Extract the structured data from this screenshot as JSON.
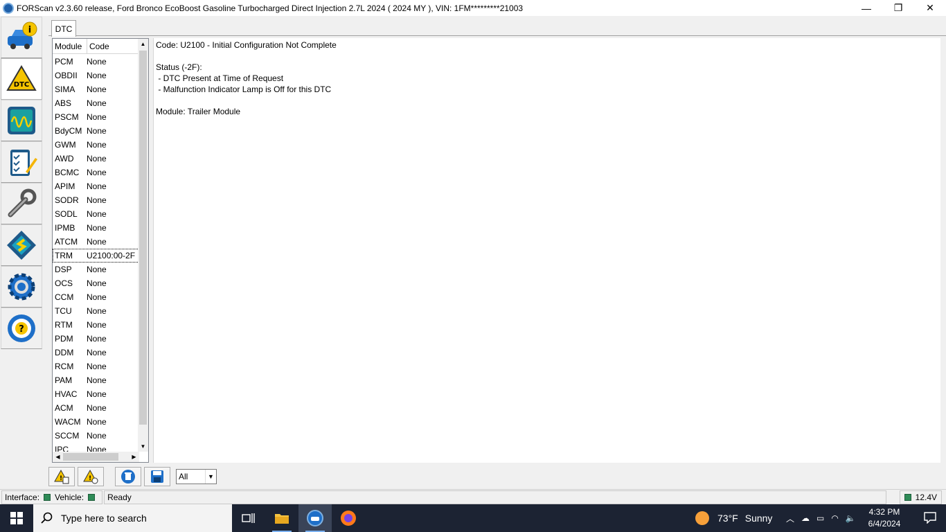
{
  "window": {
    "title": "FORScan v2.3.60 release, Ford Bronco EcoBoost Gasoline Turbocharged Direct Injection 2.7L 2024 ( 2024 MY ), VIN: 1FM*********21003",
    "minimize_glyph": "—",
    "restore_glyph": "❐",
    "close_glyph": "✕"
  },
  "sidebar": {
    "items": [
      {
        "icon": "vehicle-info-icon"
      },
      {
        "icon": "dtc-warning-icon",
        "label": "DTC",
        "active": true
      },
      {
        "icon": "oscilloscope-icon"
      },
      {
        "icon": "checklist-icon"
      },
      {
        "icon": "wrench-icon"
      },
      {
        "icon": "chip-icon"
      },
      {
        "icon": "settings-gear-icon"
      },
      {
        "icon": "help-steering-icon"
      }
    ]
  },
  "tabs": [
    {
      "label": "DTC"
    }
  ],
  "module_list": {
    "headers": {
      "module": "Module",
      "code": "Code"
    },
    "rows": [
      {
        "module": "PCM",
        "code": "None"
      },
      {
        "module": "OBDII",
        "code": "None"
      },
      {
        "module": "SIMA",
        "code": "None"
      },
      {
        "module": "ABS",
        "code": "None"
      },
      {
        "module": "PSCM",
        "code": "None"
      },
      {
        "module": "BdyCM",
        "code": "None"
      },
      {
        "module": "GWM",
        "code": "None"
      },
      {
        "module": "AWD",
        "code": "None"
      },
      {
        "module": "BCMC",
        "code": "None"
      },
      {
        "module": "APIM",
        "code": "None"
      },
      {
        "module": "SODR",
        "code": "None"
      },
      {
        "module": "SODL",
        "code": "None"
      },
      {
        "module": "IPMB",
        "code": "None"
      },
      {
        "module": "ATCM",
        "code": "None"
      },
      {
        "module": "TRM",
        "code": "U2100:00-2F",
        "selected": true
      },
      {
        "module": "DSP",
        "code": "None"
      },
      {
        "module": "OCS",
        "code": "None"
      },
      {
        "module": "CCM",
        "code": "None"
      },
      {
        "module": "TCU",
        "code": "None"
      },
      {
        "module": "RTM",
        "code": "None"
      },
      {
        "module": "PDM",
        "code": "None"
      },
      {
        "module": "DDM",
        "code": "None"
      },
      {
        "module": "RCM",
        "code": "None"
      },
      {
        "module": "PAM",
        "code": "None"
      },
      {
        "module": "HVAC",
        "code": "None"
      },
      {
        "module": "ACM",
        "code": "None"
      },
      {
        "module": "WACM",
        "code": "None"
      },
      {
        "module": "SCCM",
        "code": "None"
      },
      {
        "module": "IPC",
        "code": "None"
      }
    ]
  },
  "detail": {
    "text": "Code: U2100 - Initial Configuration Not Complete\n\nStatus (-2F):\n - DTC Present at Time of Request\n - Malfunction Indicator Lamp is Off for this DTC\n\nModule: Trailer Module"
  },
  "toolbar": {
    "buttons": [
      {
        "icon": "read-dtc-icon"
      },
      {
        "icon": "clear-dtc-icon"
      },
      {
        "icon": "delete-icon"
      },
      {
        "icon": "save-icon"
      }
    ],
    "filter_value": "All"
  },
  "statusbar": {
    "interface_label": "Interface:",
    "vehicle_label": "Vehicle:",
    "status_text": "Ready",
    "voltage": "12.4V",
    "led_color": "#2e8b57"
  },
  "taskbar": {
    "search_placeholder": "Type here to search",
    "weather_temp": "73°F",
    "weather_text": "Sunny",
    "time": "4:32 PM",
    "date": "6/4/2024"
  }
}
